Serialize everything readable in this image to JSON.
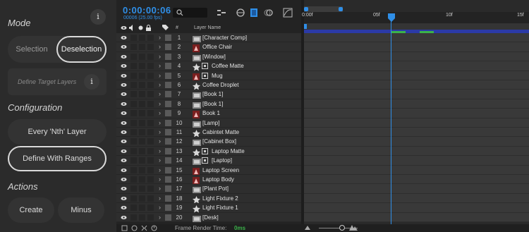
{
  "left_panel": {
    "mode": {
      "title": "Mode",
      "info_icon": "i",
      "options": [
        "Selection",
        "Deselection"
      ],
      "selected": "Deselection"
    },
    "target": {
      "placeholder": "Define Target Layers",
      "info_icon": "i"
    },
    "configuration": {
      "title": "Configuration",
      "options": [
        "Every 'Nth' Layer",
        "Define With Ranges"
      ],
      "selected": "Define With Ranges"
    },
    "actions": {
      "title": "Actions",
      "buttons": [
        "Create",
        "Minus"
      ]
    }
  },
  "timeline_header": {
    "timecode": "0:00:00:06",
    "frame_info": "00006 (25.00 fps)",
    "ruler_ticks": [
      "0:00f",
      "05f",
      "10f",
      "15f"
    ],
    "playhead_frame": 6
  },
  "columns": {
    "number": "#",
    "layer_name": "Layer Name"
  },
  "layers": [
    {
      "num": "1",
      "name": "[Character Comp]",
      "icon": "composition-icon",
      "star": false,
      "box": false
    },
    {
      "num": "2",
      "name": "Office Chair",
      "icon": "shape-layer-icon",
      "star": false,
      "box": false
    },
    {
      "num": "3",
      "name": "[Window]",
      "icon": "composition-icon",
      "star": false,
      "box": false
    },
    {
      "num": "4",
      "name": "Coffee Matte",
      "icon": "star-icon",
      "star": true,
      "box": true
    },
    {
      "num": "5",
      "name": "Mug",
      "icon": "shape-layer-icon",
      "star": false,
      "box": true
    },
    {
      "num": "6",
      "name": "Coffee Droplet",
      "icon": "star-icon",
      "star": true,
      "box": false
    },
    {
      "num": "7",
      "name": "[Book 1]",
      "icon": "composition-icon",
      "star": false,
      "box": false
    },
    {
      "num": "8",
      "name": "[Book 1]",
      "icon": "composition-icon",
      "star": false,
      "box": false
    },
    {
      "num": "9",
      "name": "Book 1",
      "icon": "shape-layer-icon",
      "star": false,
      "box": false
    },
    {
      "num": "10",
      "name": "[Lamp]",
      "icon": "composition-icon",
      "star": false,
      "box": false
    },
    {
      "num": "11",
      "name": "Cabintet Matte",
      "icon": "star-icon",
      "star": true,
      "box": false
    },
    {
      "num": "12",
      "name": "[Cabinet Box]",
      "icon": "composition-icon",
      "star": false,
      "box": false
    },
    {
      "num": "13",
      "name": "Laptop Matte",
      "icon": "star-icon",
      "star": true,
      "box": true
    },
    {
      "num": "14",
      "name": "[Laptop]",
      "icon": "composition-icon",
      "star": false,
      "box": true
    },
    {
      "num": "15",
      "name": "Laptop Screen",
      "icon": "shape-layer-icon",
      "star": false,
      "box": false
    },
    {
      "num": "16",
      "name": "Laptop Body",
      "icon": "shape-layer-icon",
      "star": false,
      "box": false
    },
    {
      "num": "17",
      "name": "[Plant Pot]",
      "icon": "composition-icon",
      "star": false,
      "box": false
    },
    {
      "num": "18",
      "name": "Light Fixture 2",
      "icon": "star-icon",
      "star": true,
      "box": false
    },
    {
      "num": "19",
      "name": "Light Fixture 1",
      "icon": "star-icon",
      "star": true,
      "box": false
    },
    {
      "num": "20",
      "name": "[Desk]",
      "icon": "composition-icon",
      "star": false,
      "box": false
    }
  ],
  "footer": {
    "label": "Frame Render Time:",
    "value": "0ms"
  },
  "colors": {
    "accent": "#2f8fe8",
    "work_area": "#2b3aa6",
    "keyframe": "#3bb24a"
  }
}
